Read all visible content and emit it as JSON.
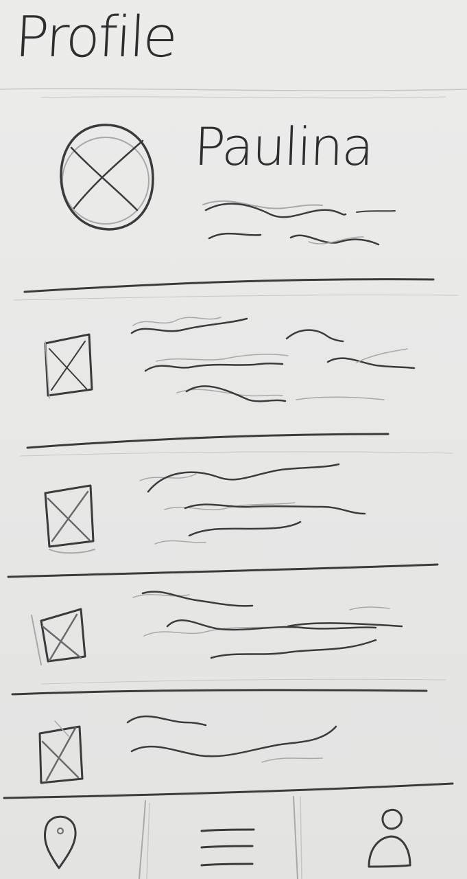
{
  "header": {
    "title": "Profile"
  },
  "profile": {
    "name": "Paulina"
  },
  "list": {
    "items": [
      {
        "thumb_icon": "image-placeholder-icon"
      },
      {
        "thumb_icon": "image-placeholder-icon"
      },
      {
        "thumb_icon": "image-placeholder-icon"
      },
      {
        "thumb_icon": "image-placeholder-icon"
      }
    ]
  },
  "bottom_nav": {
    "tabs": [
      {
        "icon": "location-pin-icon"
      },
      {
        "icon": "menu-icon"
      },
      {
        "icon": "user-icon",
        "selected": true
      }
    ]
  }
}
